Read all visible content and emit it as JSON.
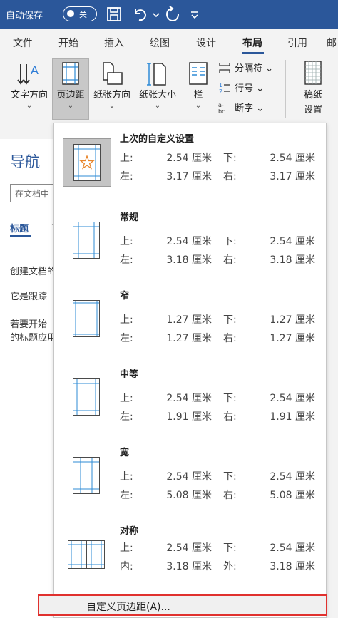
{
  "titlebar": {
    "autosave_label": "自动保存",
    "autosave_state": "关"
  },
  "tabs": [
    "文件",
    "开始",
    "插入",
    "绘图",
    "设计",
    "布局",
    "引用",
    "邮"
  ],
  "active_tab": "布局",
  "ribbon": {
    "text_direction": "文字方向",
    "margins": "页边距",
    "orientation": "纸张方向",
    "size": "纸张大小",
    "columns": "栏",
    "breaks": "分隔符",
    "line_numbers": "行号",
    "hyphenation": "断字",
    "manuscript": "稿纸",
    "settings": "设置",
    "chevron": "⌄"
  },
  "nav": {
    "title": "导航",
    "search_placeholder": "在文档中",
    "tab_headings": "标题",
    "tab_pages": "页",
    "line1": "创建文档的",
    "line2": "它是跟踪",
    "line3": "若要开始",
    "line4": "的标题应用"
  },
  "dropdown": {
    "items": [
      {
        "name": "上次的自定义设置",
        "l1a": "上:",
        "v1a": "2.54 厘米",
        "l1b": "下:",
        "v1b": "2.54 厘米",
        "l2a": "左:",
        "v2a": "3.17 厘米",
        "l2b": "右:",
        "v2b": "3.17 厘米"
      },
      {
        "name": "常规",
        "l1a": "上:",
        "v1a": "2.54 厘米",
        "l1b": "下:",
        "v1b": "2.54 厘米",
        "l2a": "左:",
        "v2a": "3.18 厘米",
        "l2b": "右:",
        "v2b": "3.18 厘米"
      },
      {
        "name": "窄",
        "l1a": "上:",
        "v1a": "1.27 厘米",
        "l1b": "下:",
        "v1b": "1.27 厘米",
        "l2a": "左:",
        "v2a": "1.27 厘米",
        "l2b": "右:",
        "v2b": "1.27 厘米"
      },
      {
        "name": "中等",
        "l1a": "上:",
        "v1a": "2.54 厘米",
        "l1b": "下:",
        "v1b": "2.54 厘米",
        "l2a": "左:",
        "v2a": "1.91 厘米",
        "l2b": "右:",
        "v2b": "1.91 厘米"
      },
      {
        "name": "宽",
        "l1a": "上:",
        "v1a": "2.54 厘米",
        "l1b": "下:",
        "v1b": "2.54 厘米",
        "l2a": "左:",
        "v2a": "5.08 厘米",
        "l2b": "右:",
        "v2b": "5.08 厘米"
      },
      {
        "name": "对称",
        "l1a": "上:",
        "v1a": "2.54 厘米",
        "l1b": "下:",
        "v1b": "2.54 厘米",
        "l2a": "内:",
        "v2a": "3.18 厘米",
        "l2b": "外:",
        "v2b": "3.18 厘米"
      }
    ],
    "custom_label": "自定义页边距(A)..."
  },
  "colors": {
    "title_bar": "#2b579a",
    "margin_guide": "#2e8bd6",
    "star": "#e8862c",
    "highlight_box": "#e0312e"
  }
}
